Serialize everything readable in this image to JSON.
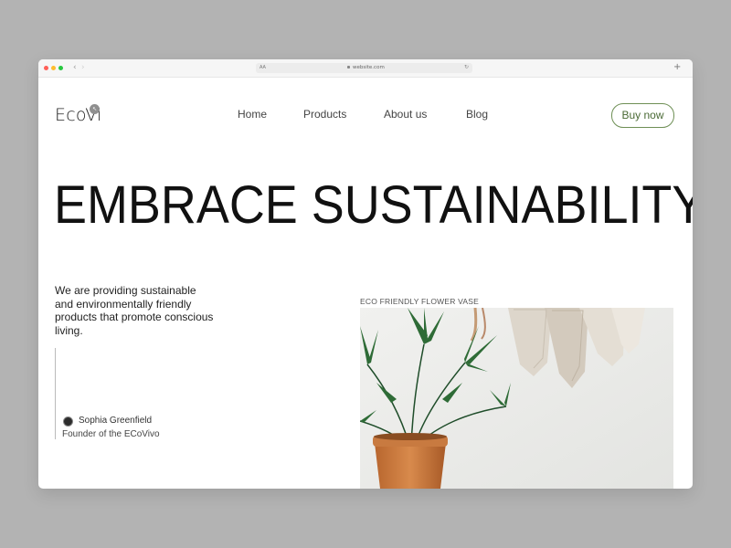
{
  "browser": {
    "reader_label": "AA",
    "url": "website.com",
    "reload_icon": "reload-icon",
    "new_tab_label": "+"
  },
  "header": {
    "logo": "EcoVi",
    "nav": [
      "Home",
      "Products",
      "About us",
      "Blog"
    ],
    "cta": "Buy now"
  },
  "hero": {
    "headline": "EMBRACE SUSTAINABILITY"
  },
  "intro": {
    "text": "We are providing sustainable and environmentally friendly products that promote conscious living."
  },
  "author": {
    "name": "Sophia Greenfield",
    "title": "Founder of the ECoVivo"
  },
  "feature": {
    "caption": "ECO FRIENDLY FLOWER VASE"
  },
  "colors": {
    "page_background": "#b3b3b3",
    "accent": "#6e8f55",
    "text": "#111111"
  }
}
